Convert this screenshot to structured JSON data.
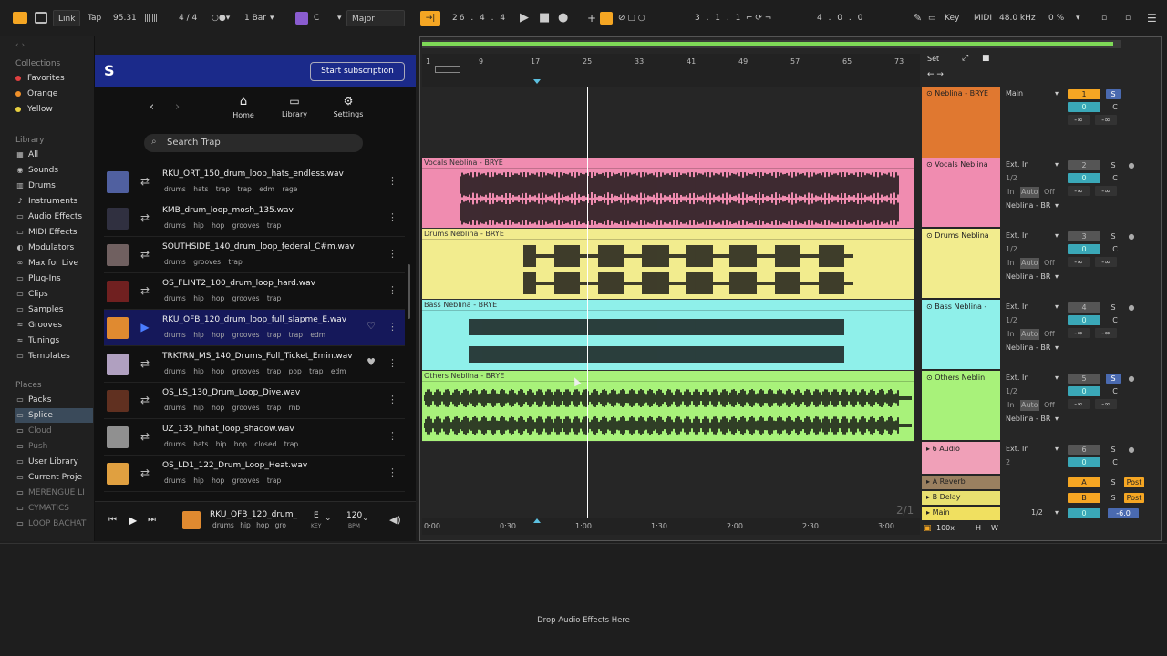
{
  "topbar": {
    "link": "Link",
    "tap": "Tap",
    "bpm": "95.31",
    "sig": "4 / 4",
    "quant": "1 Bar",
    "key_root": "C",
    "scale": "Major",
    "pos1": "26 . 4 . 4",
    "pos2": "3 . 1 . 1",
    "pos3": "4 . 0 . 0",
    "key_label": "Key",
    "midi_label": "MIDI",
    "sample_rate": "48.0 kHz",
    "cpu": "0 %"
  },
  "sidebar": {
    "collections_head": "Collections",
    "collections": [
      {
        "label": "Favorites",
        "color": "#e04040"
      },
      {
        "label": "Orange",
        "color": "#f0902a"
      },
      {
        "label": "Yellow",
        "color": "#e8d040"
      }
    ],
    "library_head": "Library",
    "library": [
      "All",
      "Sounds",
      "Drums",
      "Instruments",
      "Audio Effects",
      "MIDI Effects",
      "Modulators",
      "Max for Live",
      "Plug-Ins",
      "Clips",
      "Samples",
      "Grooves",
      "Tunings",
      "Templates"
    ],
    "places_head": "Places",
    "places": [
      "Packs",
      "Splice",
      "Cloud",
      "Push",
      "User Library",
      "Current Proje",
      "MERENGUE LI",
      "CYMATICS",
      "LOOP BACHAT"
    ]
  },
  "splice": {
    "subscribe": "Start subscription",
    "home": "Home",
    "library": "Library",
    "settings": "Settings",
    "search_placeholder": "Search Trap",
    "rows": [
      {
        "name": "RKU_ORT_150_drum_loop_hats_endless.wav",
        "tags": "drums hats trap trap edm rage",
        "color": "#5060a0"
      },
      {
        "name": "KMB_drum_loop_mosh_135.wav",
        "tags": "drums hip hop grooves trap",
        "color": "#303040"
      },
      {
        "name": "SOUTHSIDE_140_drum_loop_federal_C#m.wav",
        "tags": "drums grooves trap",
        "color": "#706060"
      },
      {
        "name": "OS_FLINT2_100_drum_loop_hard.wav",
        "tags": "drums hip hop grooves trap",
        "color": "#702020"
      },
      {
        "name": "RKU_OFB_120_drum_loop_full_slapme_E.wav",
        "tags": "drums hip hop grooves trap trap edm",
        "color": "#e08a30"
      },
      {
        "name": "TRKTRN_MS_140_Drums_Full_Ticket_Emin.wav",
        "tags": "drums hip hop grooves trap pop trap edm",
        "color": "#b0a0c0"
      },
      {
        "name": "OS_LS_130_Drum_Loop_Dive.wav",
        "tags": "drums hip hop grooves trap rnb",
        "color": "#603020"
      },
      {
        "name": "UZ_135_hihat_loop_shadow.wav",
        "tags": "drums hats hip hop closed trap",
        "color": "#909090"
      },
      {
        "name": "OS_LD1_122_Drum_Loop_Heat.wav",
        "tags": "drums hip hop grooves trap",
        "color": "#e0a040"
      }
    ],
    "player": {
      "name": "RKU_OFB_120_drum_",
      "tags": "drums hip hop gro",
      "key": "E",
      "key_label": "KEY",
      "bpm": "120",
      "bpm_label": "BPM"
    }
  },
  "arrangement": {
    "bars": [
      "1",
      "9",
      "17",
      "25",
      "33",
      "41",
      "49",
      "57",
      "65",
      "73"
    ],
    "times": [
      "0:00",
      "0:30",
      "1:00",
      "1:30",
      "2:00",
      "2:30",
      "3:00"
    ],
    "ratio": "2/1",
    "set": "Set",
    "zoom": "100x",
    "tracks": [
      {
        "clip": "Vocals Neblina - BRYE",
        "name": "Vocals Neblina",
        "color": "#f08cb0",
        "num": "2",
        "pan": "0",
        "send": "C"
      },
      {
        "clip": "Drums Neblina - BRYE",
        "name": "Drums Neblina",
        "color": "#f2ec8e",
        "num": "3",
        "pan": "0",
        "send": "C"
      },
      {
        "clip": "Bass Neblina - BRYE",
        "name": "Bass Neblina -",
        "color": "#8ff0ea",
        "num": "4",
        "pan": "0",
        "send": "C"
      },
      {
        "clip": "Others Neblina - BRYE",
        "name": "Others Neblin",
        "color": "#a8f27a",
        "num": "5",
        "pan": "0",
        "send": "C"
      }
    ],
    "top_track": {
      "name": "Neblina - BRYE",
      "color": "#e07830",
      "out": "Main",
      "num": "1"
    },
    "audio6": {
      "name": "6 Audio",
      "in": "Ext. In",
      "ch": "2",
      "num": "6"
    },
    "returns": [
      {
        "name": "A Reverb",
        "letter": "A"
      },
      {
        "name": "B Delay",
        "letter": "B"
      },
      {
        "name": "Main",
        "out": "1/2",
        "vol": "-6.0"
      }
    ],
    "ext_in": "Ext. In",
    "ch12": "1/2",
    "in_lbl": "In",
    "auto_lbl": "Auto",
    "off_lbl": "Off",
    "route": "Neblina - BR",
    "inf": "-∞",
    "s": "S",
    "post": "Post",
    "c": "C",
    "h": "H",
    "w": "W"
  },
  "bottom": {
    "drop": "Drop Audio Effects Here"
  }
}
